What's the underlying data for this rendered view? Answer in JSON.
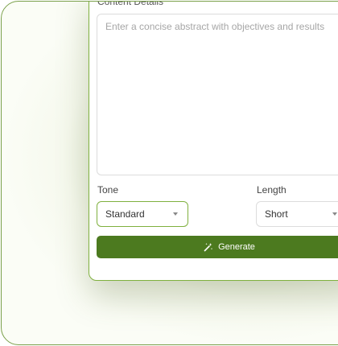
{
  "content": {
    "section_label": "Content Details",
    "placeholder": "Enter a concise abstract with objectives and results",
    "value": ""
  },
  "tone": {
    "label": "Tone",
    "selected": "Standard"
  },
  "length": {
    "label": "Length",
    "selected": "Short"
  },
  "generate": {
    "label": "Generate",
    "icon": "magic-wand-icon"
  },
  "colors": {
    "accent": "#4c7a1f",
    "border_active": "#7fb03e",
    "border_default": "#dcdcdc"
  }
}
